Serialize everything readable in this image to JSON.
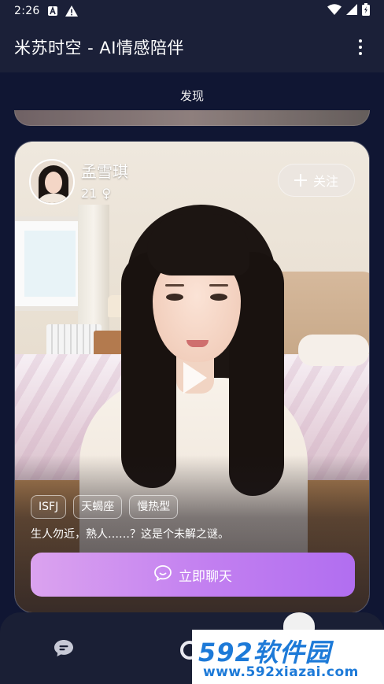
{
  "status_bar": {
    "time": "2:26",
    "icons": [
      "notification-a-icon",
      "warning-icon",
      "wifi-icon",
      "signal-icon",
      "battery-icon"
    ]
  },
  "app_bar": {
    "title": "米苏时空 - AI情感陪伴"
  },
  "tabs": [
    {
      "label": "发现"
    }
  ],
  "profile_card": {
    "name": "孟雪琪",
    "age": "21",
    "gender_symbol": "♀",
    "follow_label": "关注",
    "tags": [
      "ISFJ",
      "天蝎座",
      "慢热型"
    ],
    "description": "生人勿近，熟人……？这是个未解之谜。",
    "chat_label": "立即聊天"
  },
  "colors": {
    "background": "#101633",
    "appbar": "#1b2038",
    "chat_button_start": "#dba3ef",
    "chat_button_end": "#b16ef0",
    "watermark_blue": "#1d7ad8"
  },
  "watermark": {
    "brand": "592软件园",
    "url": "www.592xiazai.com"
  }
}
